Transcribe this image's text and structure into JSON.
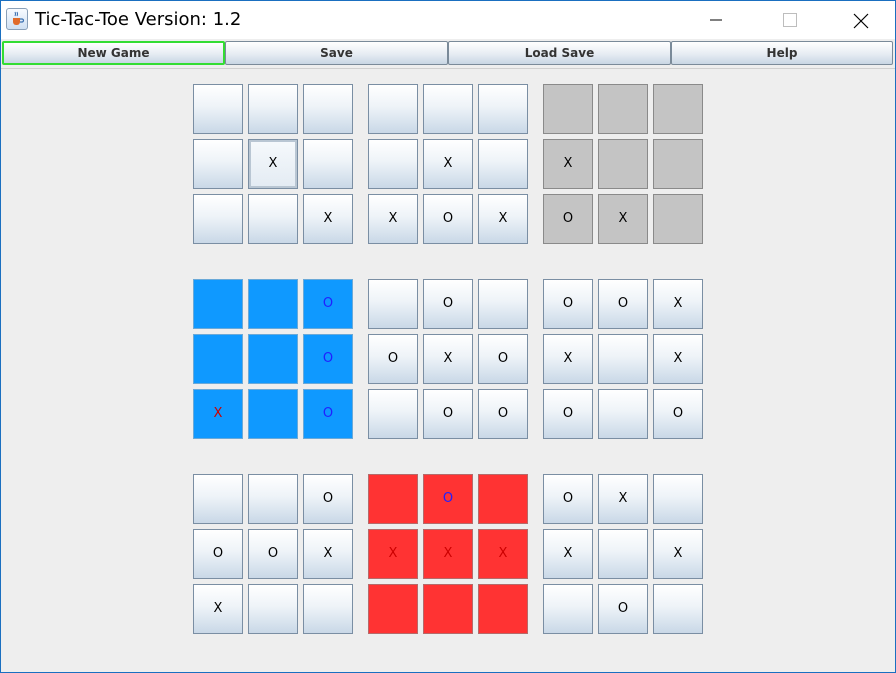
{
  "window": {
    "title": "Tic-Tac-Toe Version: 1.2",
    "icon": "java-cup-icon",
    "controls": [
      "minimize-icon",
      "maximize-icon",
      "close-icon"
    ]
  },
  "toolbar": {
    "buttons": [
      {
        "label": "New Game",
        "focused": true
      },
      {
        "label": "Save",
        "focused": false
      },
      {
        "label": "Load Save",
        "focused": false
      },
      {
        "label": "Help",
        "focused": false
      }
    ]
  },
  "colors": {
    "won_gray": "#c4c4c4",
    "won_blue": "#0f99ff",
    "won_red": "#ff3333",
    "focus_border": "#33dd33"
  },
  "board": {
    "boards": [
      {
        "state": "open",
        "cells": [
          "",
          "",
          "",
          "",
          "X",
          "",
          "",
          "",
          "X"
        ],
        "pressed_cells": [
          4
        ]
      },
      {
        "state": "open",
        "cells": [
          "",
          "",
          "",
          "",
          "X",
          "",
          "X",
          "O",
          "X"
        ]
      },
      {
        "state": "won-gray",
        "cells": [
          "",
          "",
          "",
          "X",
          "",
          "",
          "O",
          "X",
          ""
        ]
      },
      {
        "state": "won-blue",
        "cells": [
          "",
          "",
          "O",
          "",
          "",
          "O",
          "X",
          "",
          "O"
        ]
      },
      {
        "state": "open",
        "cells": [
          "",
          "O",
          "",
          "O",
          "X",
          "O",
          "",
          "O",
          "O"
        ]
      },
      {
        "state": "open",
        "cells": [
          "O",
          "O",
          "X",
          "X",
          "",
          "X",
          "O",
          "",
          "O"
        ]
      },
      {
        "state": "open",
        "cells": [
          "",
          "",
          "O",
          "O",
          "O",
          "X",
          "X",
          "",
          ""
        ]
      },
      {
        "state": "won-red",
        "cells": [
          "",
          "O",
          "",
          "X",
          "X",
          "X",
          "",
          "",
          ""
        ]
      },
      {
        "state": "open",
        "cells": [
          "O",
          "X",
          "",
          "X",
          "",
          "X",
          "",
          "O",
          ""
        ]
      }
    ]
  }
}
